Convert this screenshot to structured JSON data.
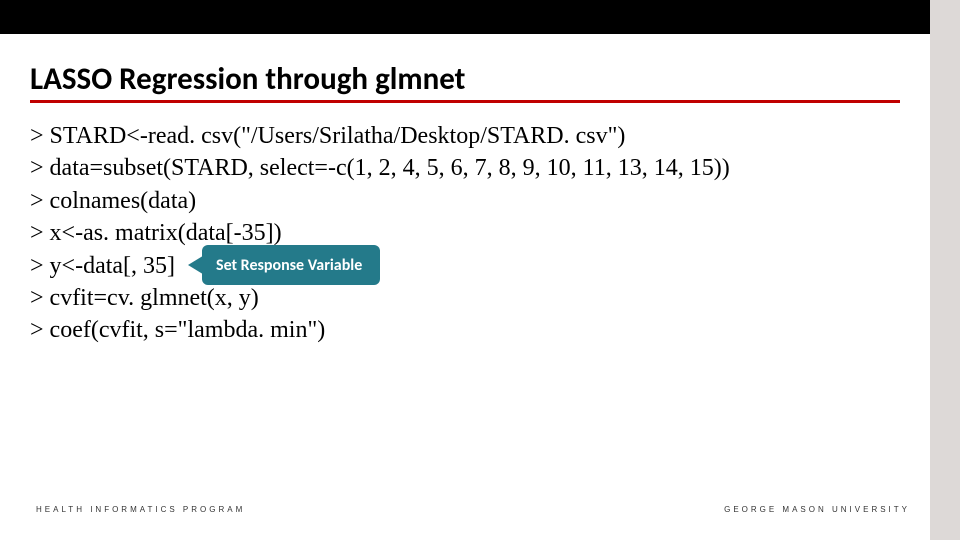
{
  "title": "LASSO Regression through glmnet",
  "code": {
    "lines": [
      "> STARD<-read. csv(\"/Users/Srilatha/Desktop/STARD. csv\")",
      "> data=subset(STARD, select=-c(1, 2, 4, 5, 6, 7, 8, 9, 10, 11, 13, 14, 15))",
      "> colnames(data)",
      "> x<-as. matrix(data[-35])",
      "> y<-data[, 35]",
      "> cvfit=cv. glmnet(x, y)",
      "> coef(cvfit, s=\"lambda. min\")"
    ]
  },
  "callout": {
    "label": "Set Response Variable"
  },
  "footer": {
    "left": "HEALTH INFORMATICS PROGRAM",
    "right": "GEORGE MASON UNIVERSITY"
  }
}
